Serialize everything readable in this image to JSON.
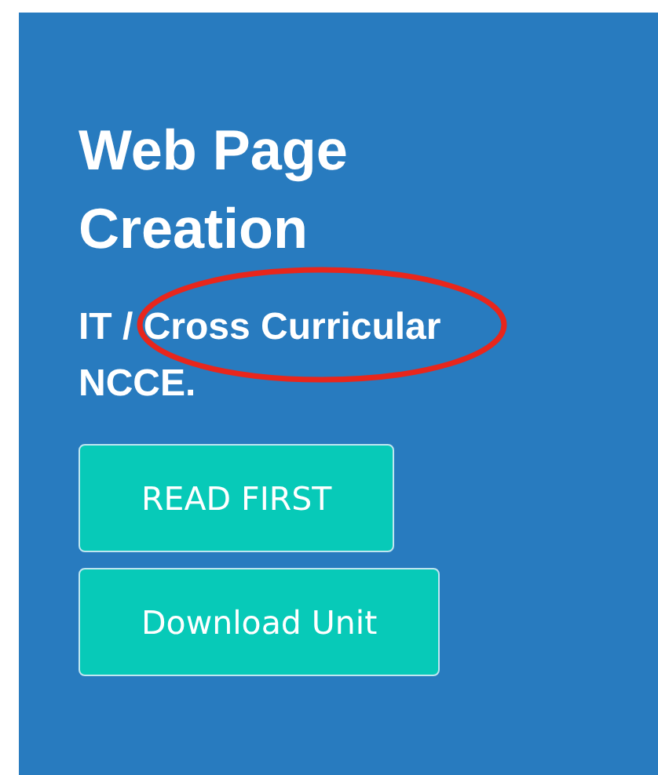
{
  "hero": {
    "title": "Web Page Creation",
    "subtitle_lines": [
      "IT / Cross Curricular",
      "NCCE."
    ]
  },
  "buttons": [
    {
      "label": "READ FIRST"
    },
    {
      "label": "Download Unit"
    }
  ]
}
